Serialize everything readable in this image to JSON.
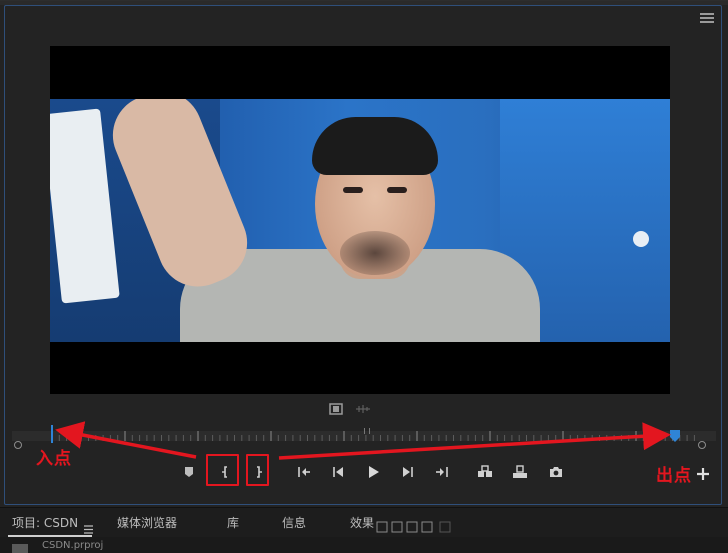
{
  "annotations": {
    "in_point": "入点",
    "out_point": "出点"
  },
  "tabs": {
    "project": "项目: CSDN",
    "media_browser": "媒体浏览器",
    "library": "库",
    "info": "信息",
    "effects": "效果"
  },
  "project_file": "CSDN.prproj",
  "colors": {
    "accent_blue": "#2f84d6",
    "annotation_red": "#e3161f"
  },
  "icons": {
    "panel_menu": "hamburger-icon",
    "marker": "add-marker-icon",
    "mark_in": "mark-in-icon",
    "mark_out": "mark-out-icon",
    "go_to_in": "go-to-in-icon",
    "step_back": "step-back-icon",
    "play": "play-icon",
    "step_forward": "step-forward-icon",
    "go_to_out": "go-to-out-icon",
    "insert": "insert-icon",
    "overwrite": "overwrite-icon",
    "export_frame": "camera-icon",
    "add_button": "plus-icon"
  }
}
